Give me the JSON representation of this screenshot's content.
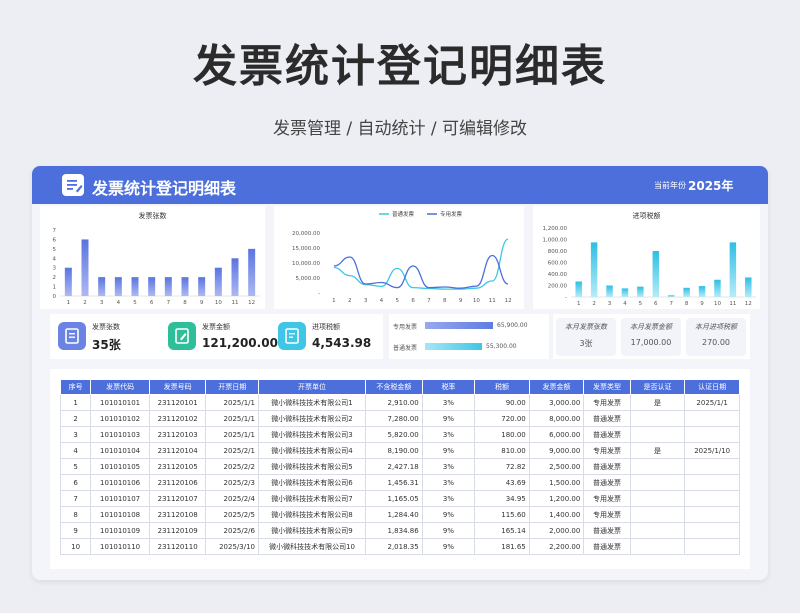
{
  "page": {
    "title": "发票统计登记明细表",
    "subtitle": "发票管理 / 自动统计 / 可编辑修改"
  },
  "header": {
    "title": "发票统计登记明细表",
    "year_label": "当前年份",
    "year": "2025年"
  },
  "colors": {
    "accent": "#4c6fdc",
    "bar_blue": "#6b83e3",
    "cyan": "#3fc6e6",
    "green": "#2fbe9a"
  },
  "chart_data": [
    {
      "type": "bar",
      "title": "发票张数",
      "categories": [
        "1",
        "2",
        "3",
        "4",
        "5",
        "6",
        "7",
        "8",
        "9",
        "10",
        "11",
        "12"
      ],
      "values": [
        3,
        6,
        2,
        2,
        2,
        2,
        2,
        2,
        2,
        3,
        4,
        5
      ],
      "ylim": [
        0,
        7
      ],
      "yticks": [
        "0",
        "1",
        "2",
        "3",
        "4",
        "5",
        "6",
        "7"
      ]
    },
    {
      "type": "line",
      "categories": [
        "1",
        "2",
        "3",
        "4",
        "5",
        "6",
        "7",
        "8",
        "9",
        "10",
        "11",
        "12"
      ],
      "series": [
        {
          "name": "普通发票",
          "values": [
            8500,
            5800,
            2800,
            2200,
            8200,
            1800,
            1500,
            1300,
            1300,
            1600,
            4000,
            18000
          ]
        },
        {
          "name": "专用发票",
          "values": [
            9000,
            12000,
            3000,
            3500,
            1800,
            9000,
            1800,
            2000,
            1600,
            2300,
            12500,
            3000
          ]
        }
      ],
      "ylim": [
        0,
        20000
      ],
      "yticks": [
        "-",
        "5,000.00",
        "10,000.00",
        "15,000.00",
        "20,000.00"
      ],
      "legend": "top"
    },
    {
      "type": "bar",
      "title": "进项税额",
      "categories": [
        "1",
        "2",
        "3",
        "4",
        "5",
        "6",
        "7",
        "8",
        "9",
        "10",
        "11",
        "12"
      ],
      "values": [
        270,
        950,
        200,
        150,
        180,
        800,
        30,
        160,
        190,
        300,
        950,
        340
      ],
      "ylim": [
        0,
        1200
      ],
      "yticks": [
        "-",
        "200.00",
        "400.00",
        "600.00",
        "800.00",
        "1,000.00",
        "1,200.00"
      ]
    }
  ],
  "stats": [
    {
      "label": "发票张数",
      "value": "35张",
      "icon": "document-icon"
    },
    {
      "label": "发票金额",
      "value": "121,200.00",
      "icon": "edit-icon"
    },
    {
      "label": "进项税额",
      "value": "4,543.98",
      "icon": "ledger-icon"
    }
  ],
  "type_bars": [
    {
      "label": "专用发票",
      "value_text": "65,900.00",
      "value": 65900
    },
    {
      "label": "普通发票",
      "value_text": "55,300.00",
      "value": 55300
    }
  ],
  "month_boxes": [
    {
      "label": "本月发票张数",
      "value": "3张"
    },
    {
      "label": "本月发票金额",
      "value": "17,000.00"
    },
    {
      "label": "本月进项税额",
      "value": "270.00"
    }
  ],
  "table": {
    "headers": [
      "序号",
      "发票代码",
      "发票号码",
      "开票日期",
      "开票单位",
      "不含税金额",
      "税率",
      "税额",
      "发票金额",
      "发票类型",
      "是否认证",
      "认证日期"
    ],
    "rows": [
      [
        "1",
        "101010101",
        "231120101",
        "2025/1/1",
        "微小微科技技术有限公司1",
        "2,910.00",
        "3%",
        "90.00",
        "3,000.00",
        "专用发票",
        "是",
        "2025/1/1"
      ],
      [
        "2",
        "101010102",
        "231120102",
        "2025/1/1",
        "微小微科技技术有限公司2",
        "7,280.00",
        "9%",
        "720.00",
        "8,000.00",
        "普通发票",
        "",
        ""
      ],
      [
        "3",
        "101010103",
        "231120103",
        "2025/1/1",
        "微小微科技技术有限公司3",
        "5,820.00",
        "3%",
        "180.00",
        "6,000.00",
        "普通发票",
        "",
        ""
      ],
      [
        "4",
        "101010104",
        "231120104",
        "2025/2/1",
        "微小微科技技术有限公司4",
        "8,190.00",
        "9%",
        "810.00",
        "9,000.00",
        "专用发票",
        "是",
        "2025/1/10"
      ],
      [
        "5",
        "101010105",
        "231120105",
        "2025/2/2",
        "微小微科技技术有限公司5",
        "2,427.18",
        "3%",
        "72.82",
        "2,500.00",
        "普通发票",
        "",
        ""
      ],
      [
        "6",
        "101010106",
        "231120106",
        "2025/2/3",
        "微小微科技技术有限公司6",
        "1,456.31",
        "3%",
        "43.69",
        "1,500.00",
        "普通发票",
        "",
        ""
      ],
      [
        "7",
        "101010107",
        "231120107",
        "2025/2/4",
        "微小微科技技术有限公司7",
        "1,165.05",
        "3%",
        "34.95",
        "1,200.00",
        "专用发票",
        "",
        ""
      ],
      [
        "8",
        "101010108",
        "231120108",
        "2025/2/5",
        "微小微科技技术有限公司8",
        "1,284.40",
        "9%",
        "115.60",
        "1,400.00",
        "专用发票",
        "",
        ""
      ],
      [
        "9",
        "101010109",
        "231120109",
        "2025/2/6",
        "微小微科技技术有限公司9",
        "1,834.86",
        "9%",
        "165.14",
        "2,000.00",
        "普通发票",
        "",
        ""
      ],
      [
        "10",
        "101010110",
        "231120110",
        "2025/3/10",
        "微小微科技技术有限公司10",
        "2,018.35",
        "9%",
        "181.65",
        "2,200.00",
        "普通发票",
        "",
        ""
      ]
    ]
  }
}
